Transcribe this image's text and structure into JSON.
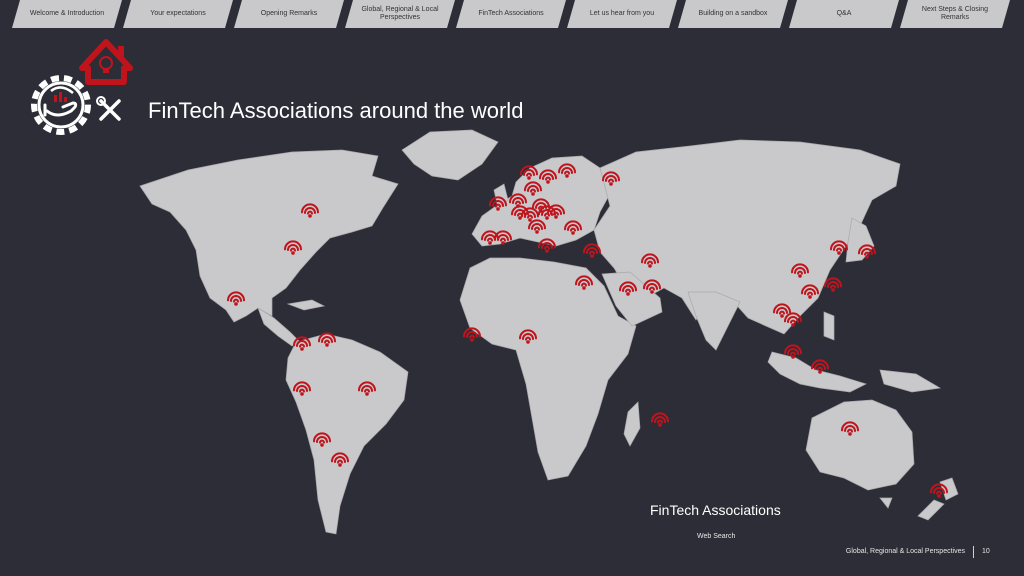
{
  "nav": {
    "tabs": [
      {
        "label": "Welcome & Introduction"
      },
      {
        "label": "Your expectations"
      },
      {
        "label": "Opening Remarks"
      },
      {
        "label": "Global, Regional & Local Perspectives"
      },
      {
        "label": "FinTech Associations"
      },
      {
        "label": "Let us hear from you"
      },
      {
        "label": "Building on a sandbox"
      },
      {
        "label": "Q&A"
      },
      {
        "label": "Next Steps & Closing Remarks"
      }
    ]
  },
  "slide": {
    "title": "FinTech Associations around the world",
    "caption": "FinTech Associations",
    "caption_sub": "Web Search"
  },
  "footer": {
    "section": "Global, Regional & Local Perspectives",
    "page_number": "10"
  },
  "colors": {
    "background": "#2d2d37",
    "land": "#c9c9cb",
    "marker": "#c0141c",
    "tab": "#c9c9cc"
  },
  "icons": {
    "logo": "gear-hand-house-logo",
    "marker": "wifi-signal-icon"
  }
}
